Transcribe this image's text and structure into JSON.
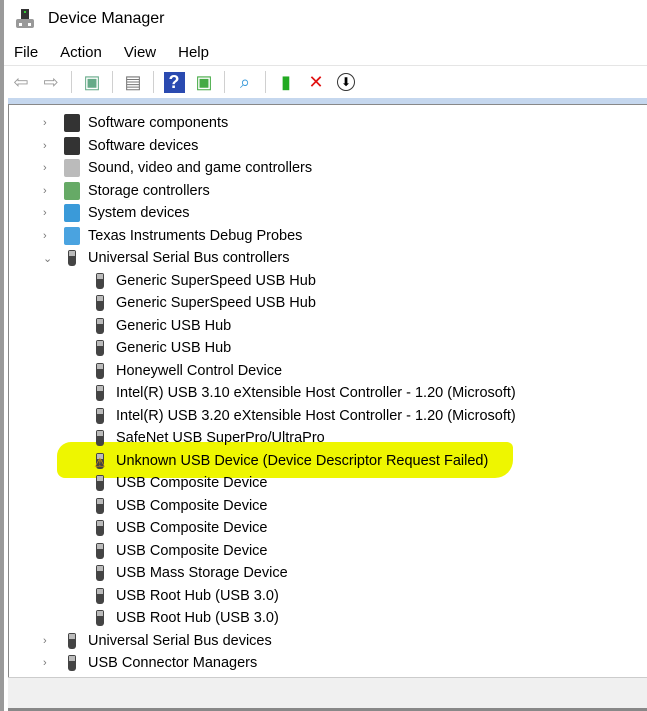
{
  "window": {
    "title": "Device Manager"
  },
  "menu": [
    "File",
    "Action",
    "View",
    "Help"
  ],
  "toolbar": [
    {
      "name": "back-button",
      "glyph": "⇦"
    },
    {
      "name": "forward-button",
      "glyph": "⇨"
    },
    {
      "name": "show-hide-console-tree-button",
      "glyph": "▣"
    },
    {
      "name": "properties-button",
      "glyph": "▤"
    },
    {
      "name": "help-button",
      "glyph": "?"
    },
    {
      "name": "show-action-pane-button",
      "glyph": "▣"
    },
    {
      "name": "scan-hardware-button",
      "glyph": "⌕"
    },
    {
      "name": "update-driver-button",
      "glyph": "▮"
    },
    {
      "name": "uninstall-device-button",
      "glyph": "✕"
    },
    {
      "name": "disable-device-button",
      "glyph": "⬇"
    }
  ],
  "tree": {
    "categories_top": [
      {
        "label": "Software components",
        "icon": "software-component-icon"
      },
      {
        "label": "Software devices",
        "icon": "software-device-icon"
      },
      {
        "label": "Sound, video and game controllers",
        "icon": "speaker-icon"
      },
      {
        "label": "Storage controllers",
        "icon": "storage-controller-icon"
      },
      {
        "label": "System devices",
        "icon": "system-device-icon"
      },
      {
        "label": "Texas Instruments Debug Probes",
        "icon": "debug-probe-icon"
      }
    ],
    "expanded": {
      "label": "Universal Serial Bus controllers",
      "children": [
        "Generic SuperSpeed USB Hub",
        "Generic SuperSpeed USB Hub",
        "Generic USB Hub",
        "Generic USB Hub",
        "Honeywell Control Device",
        "Intel(R) USB 3.10 eXtensible Host Controller - 1.20 (Microsoft)",
        "Intel(R) USB 3.20 eXtensible Host Controller - 1.20 (Microsoft)",
        "SafeNet USB SuperPro/UltraPro",
        "Unknown USB Device (Device Descriptor Request Failed)",
        "USB Composite Device",
        "USB Composite Device",
        "USB Composite Device",
        "USB Composite Device",
        "USB Mass Storage Device",
        "USB Root Hub (USB 3.0)",
        "USB Root Hub (USB 3.0)"
      ],
      "warning_index": 8
    },
    "categories_bottom": [
      {
        "label": "Universal Serial Bus devices"
      },
      {
        "label": "USB Connector Managers"
      }
    ]
  },
  "colors": {
    "highlight": "#eef600",
    "warning": "#e0a000"
  }
}
